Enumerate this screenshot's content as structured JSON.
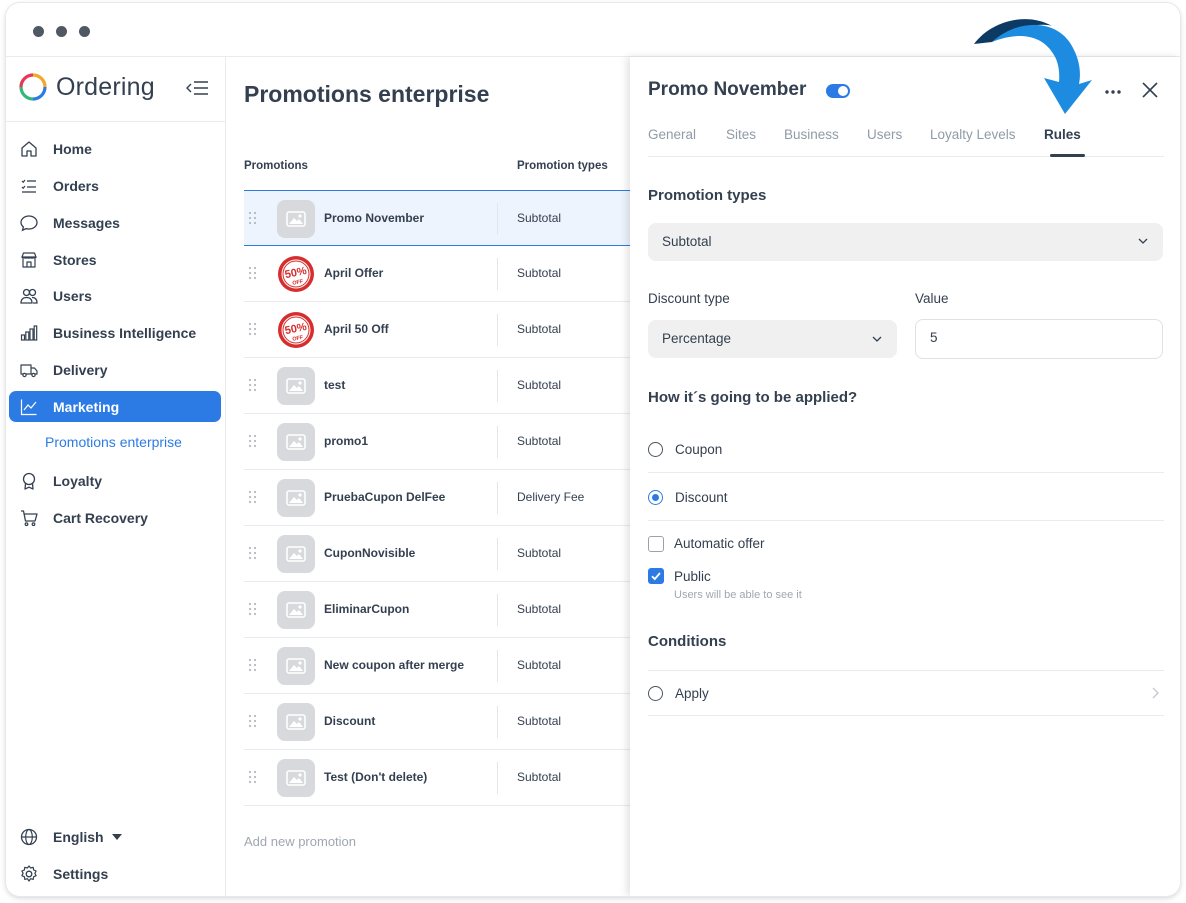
{
  "app": {
    "brand": "Ordering"
  },
  "sidebar": {
    "items": [
      {
        "label": "Home",
        "icon": "home-icon"
      },
      {
        "label": "Orders",
        "icon": "list-icon"
      },
      {
        "label": "Messages",
        "icon": "chat-icon"
      },
      {
        "label": "Stores",
        "icon": "store-icon"
      },
      {
        "label": "Users",
        "icon": "users-icon"
      },
      {
        "label": "Business Intelligence",
        "icon": "bar-chart-icon"
      },
      {
        "label": "Delivery",
        "icon": "truck-icon"
      },
      {
        "label": "Marketing",
        "icon": "line-chart-icon",
        "active": true
      },
      {
        "label": "Loyalty",
        "icon": "award-icon"
      },
      {
        "label": "Cart Recovery",
        "icon": "cart-icon"
      }
    ],
    "sub_item": "Promotions enterprise",
    "language": "English",
    "settings": "Settings"
  },
  "main": {
    "title": "Promotions enterprise",
    "columns": {
      "promotions": "Promotions",
      "types": "Promotion types"
    },
    "rows": [
      {
        "name": "Promo November",
        "type": "Subtotal",
        "thumb": "placeholder"
      },
      {
        "name": "April Offer",
        "type": "Subtotal",
        "thumb": "50-off"
      },
      {
        "name": "April 50 Off",
        "type": "Subtotal",
        "thumb": "50-off"
      },
      {
        "name": "test",
        "type": "Subtotal",
        "thumb": "placeholder"
      },
      {
        "name": "promo1",
        "type": "Subtotal",
        "thumb": "placeholder"
      },
      {
        "name": "PruebaCupon DelFee",
        "type": "Delivery Fee",
        "thumb": "placeholder"
      },
      {
        "name": "CuponNovisible",
        "type": "Subtotal",
        "thumb": "placeholder"
      },
      {
        "name": "EliminarCupon",
        "type": "Subtotal",
        "thumb": "placeholder"
      },
      {
        "name": "New coupon after merge",
        "type": "Subtotal",
        "thumb": "placeholder"
      },
      {
        "name": "Discount",
        "type": "Subtotal",
        "thumb": "placeholder"
      },
      {
        "name": "Test (Don't delete)",
        "type": "Subtotal",
        "thumb": "placeholder"
      }
    ],
    "badge_text": "50%",
    "badge_sub": "OFF",
    "add_new": "Add new promotion"
  },
  "panel": {
    "title": "Promo November",
    "enabled": true,
    "tabs": [
      "General",
      "Sites",
      "Business",
      "Users",
      "Loyalty Levels",
      "Rules"
    ],
    "active_tab": "Rules",
    "promotion_types_title": "Promotion types",
    "promotion_type_value": "Subtotal",
    "discount_type_label": "Discount type",
    "discount_type_value": "Percentage",
    "value_label": "Value",
    "value": "5",
    "applied_title": "How it´s going to be applied?",
    "applied_options": [
      {
        "label": "Coupon",
        "selected": false
      },
      {
        "label": "Discount",
        "selected": true
      }
    ],
    "automatic_offer": {
      "label": "Automatic offer",
      "checked": false
    },
    "public": {
      "label": "Public",
      "checked": true,
      "hint": "Users will be able to see it"
    },
    "conditions_title": "Conditions",
    "condition_apply": "Apply"
  },
  "colors": {
    "accent": "#2c7be5",
    "text": "#344050",
    "arrow": "#1d8ce0",
    "arrow_dark": "#0d3a63"
  }
}
